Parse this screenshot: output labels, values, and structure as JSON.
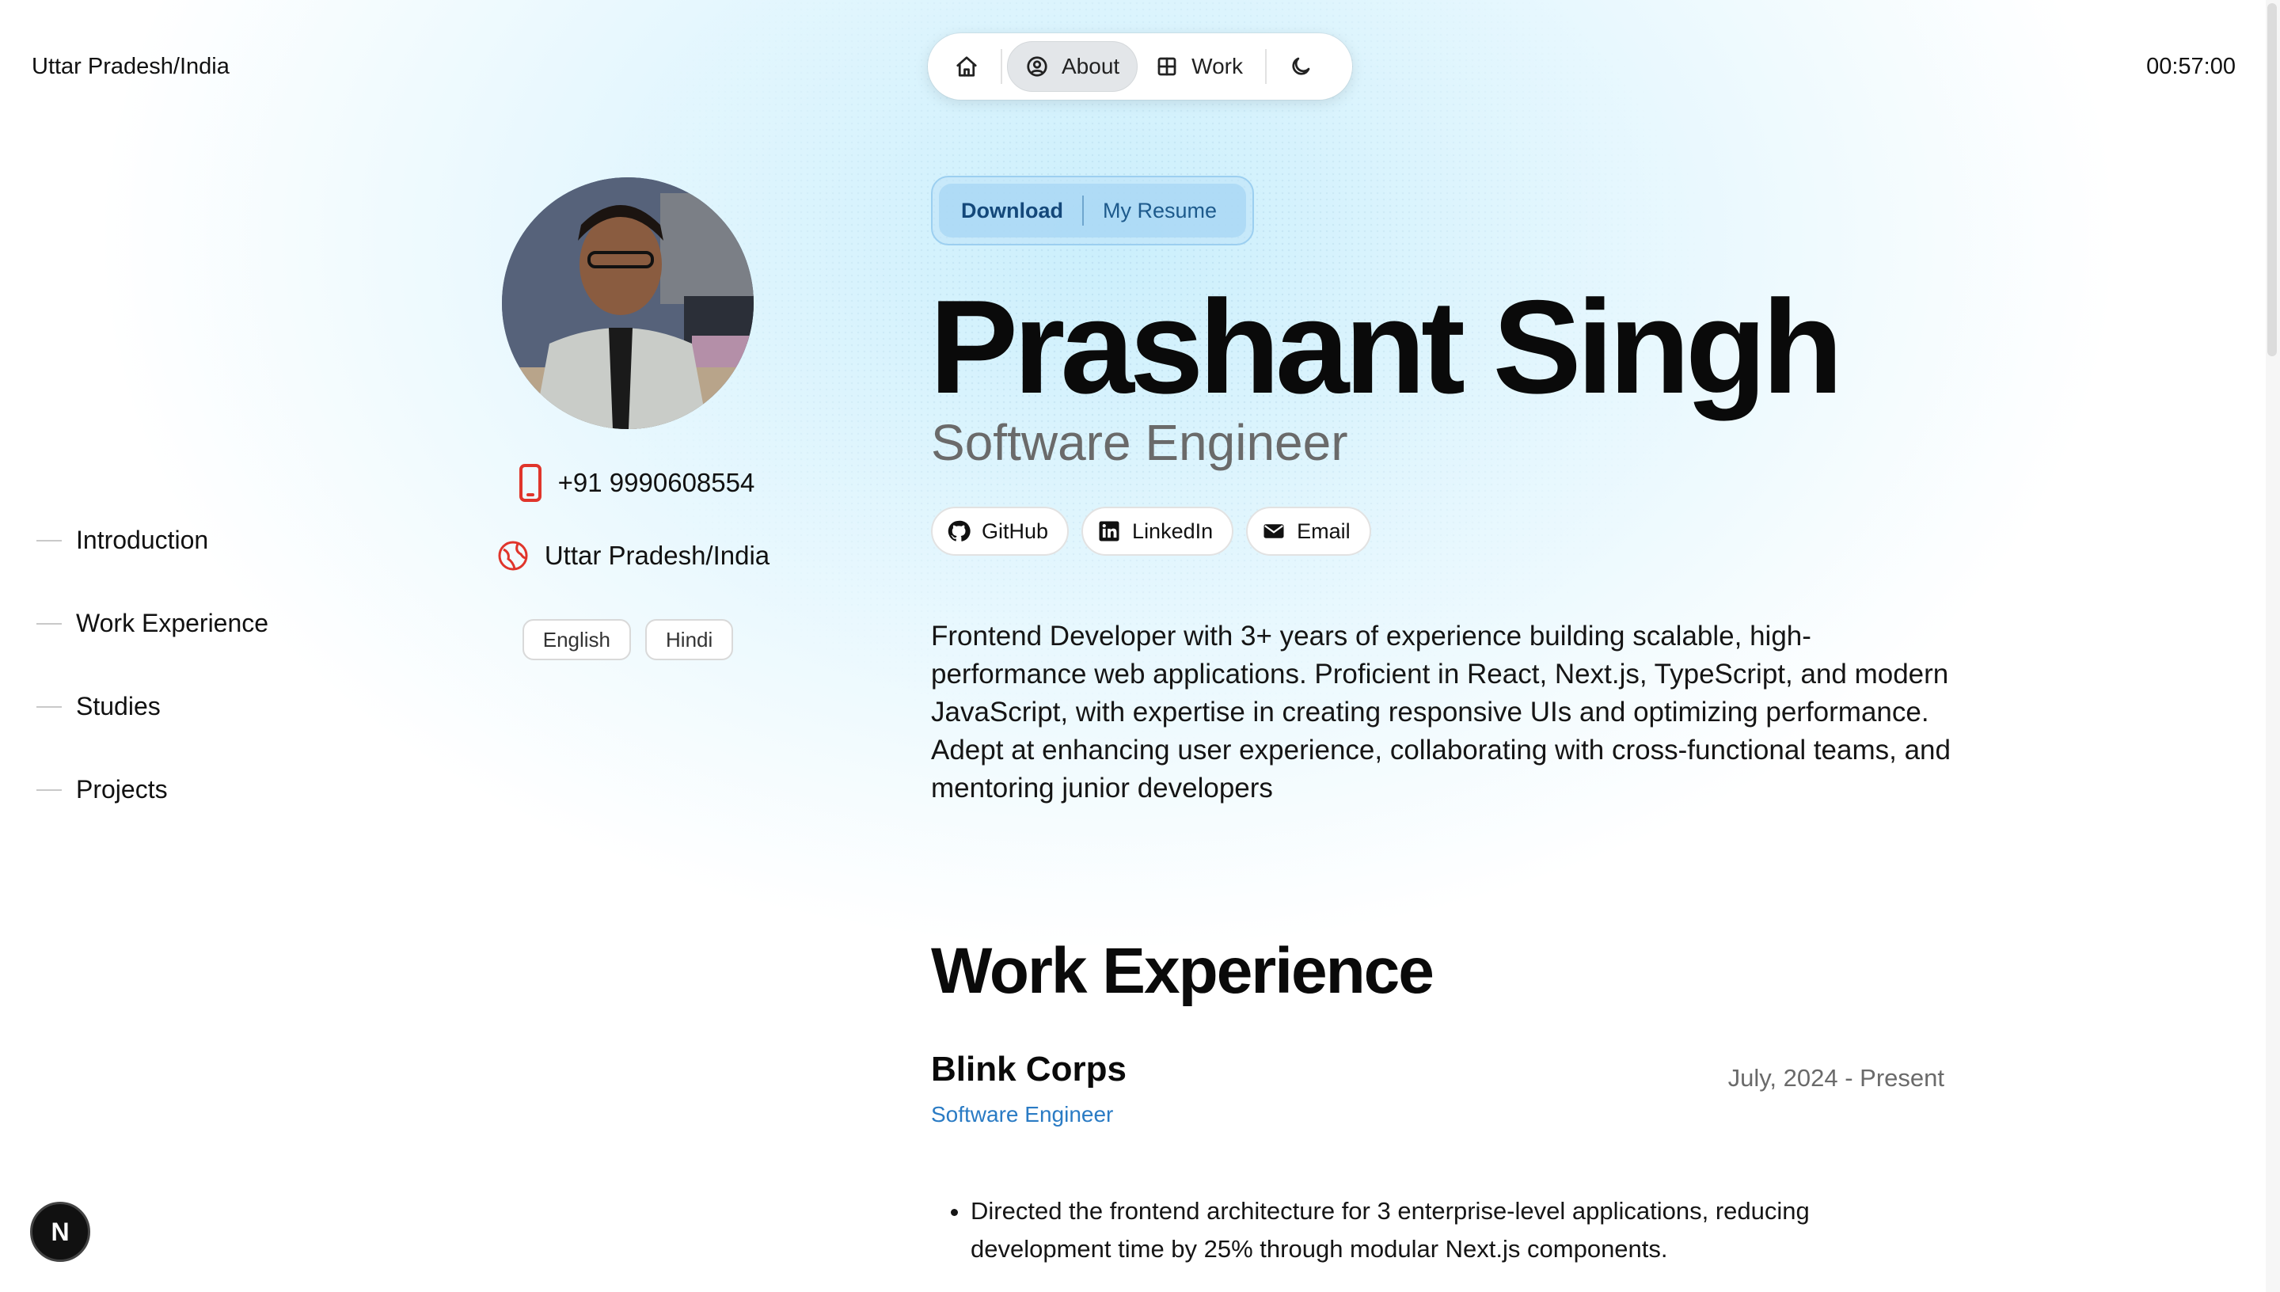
{
  "header": {
    "location": "Uttar Pradesh/India",
    "clock": "00:57:00",
    "nav": {
      "home_icon": "home-icon",
      "about_label": "About",
      "about_icon": "user-circle-icon",
      "work_label": "Work",
      "work_icon": "grid-icon",
      "theme_icon": "moon-icon"
    }
  },
  "toc": {
    "items": [
      {
        "label": "Introduction"
      },
      {
        "label": "Work Experience"
      },
      {
        "label": "Studies"
      },
      {
        "label": "Projects"
      }
    ]
  },
  "profile": {
    "avatar_alt": "avatar-photo",
    "phone": "+91 9990608554",
    "phone_icon": "phone-icon",
    "location": "Uttar Pradesh/India",
    "location_icon": "globe-icon",
    "languages": [
      "English",
      "Hindi"
    ]
  },
  "resume": {
    "download_label": "Download",
    "my_resume_label": "My Resume"
  },
  "intro": {
    "name": "Prashant Singh",
    "role": "Software Engineer",
    "socials": [
      {
        "label": "GitHub",
        "icon": "github-icon"
      },
      {
        "label": "LinkedIn",
        "icon": "linkedin-icon"
      },
      {
        "label": "Email",
        "icon": "email-icon"
      }
    ],
    "bio": "Frontend Developer with 3+ years of experience building scalable, high-performance web applications. Proficient in React, Next.js, TypeScript, and modern JavaScript, with expertise in creating responsive UIs and optimizing performance. Adept at enhancing user experience, collaborating with cross-functional teams, and mentoring junior developers"
  },
  "work": {
    "heading": "Work Experience",
    "jobs": [
      {
        "company": "Blink Corps",
        "role": "Software Engineer",
        "dates": "July, 2024 - Present",
        "bullets": [
          "Directed the frontend architecture for 3 enterprise-level applications, reducing development time by 25% through modular Next.js components."
        ]
      }
    ]
  },
  "badge": {
    "label": "N"
  },
  "colors": {
    "accent_blue": "#2a7bc4",
    "resume_bg": "#aad8f4",
    "phone_red": "#e0352b"
  }
}
